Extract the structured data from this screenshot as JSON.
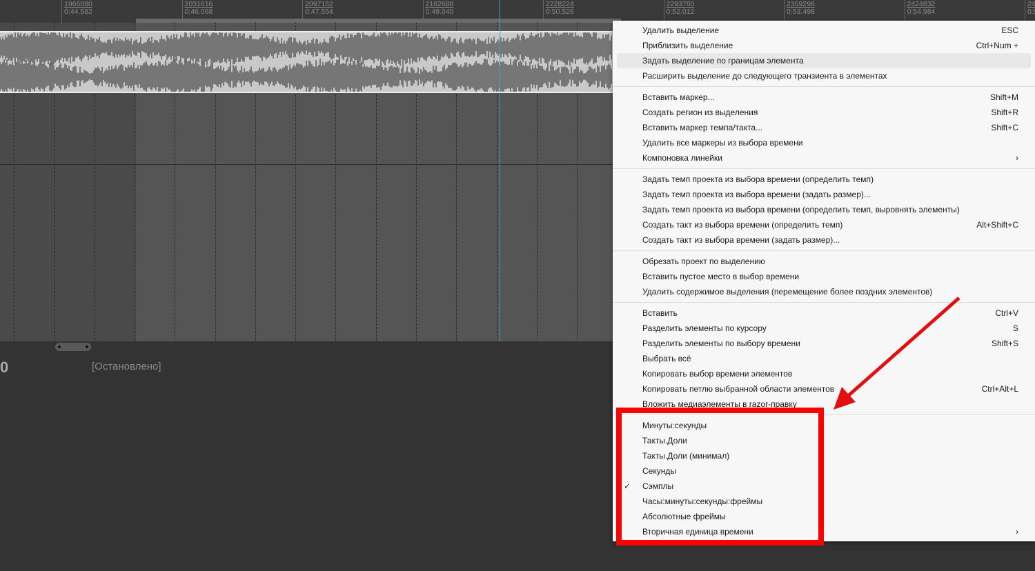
{
  "ruler": {
    "ticks": [
      {
        "samples": "1966080",
        "time": "0:44.582"
      },
      {
        "samples": "2031616",
        "time": "0:46.068"
      },
      {
        "samples": "2097152",
        "time": "0:47.554"
      },
      {
        "samples": "2162688",
        "time": "0:49.040"
      },
      {
        "samples": "2228224",
        "time": "0:50.526"
      },
      {
        "samples": "2293760",
        "time": "0:52.012"
      },
      {
        "samples": "2359296",
        "time": "0:53.498"
      },
      {
        "samples": "2424832",
        "time": "0:54.984"
      },
      {
        "samples": "24",
        "time": "0:5"
      }
    ]
  },
  "transport": {
    "timecode": "0",
    "status": "[Остановлено]"
  },
  "menu": {
    "groups": [
      [
        {
          "label": "Удалить выделение",
          "shortcut": "ESC"
        },
        {
          "label": "Приблизить выделение",
          "shortcut": "Ctrl+Num +"
        },
        {
          "label": "Задать выделение по границам элемента",
          "highlighted": true
        },
        {
          "label": "Расширить выделение до следующего транзиента в элементах"
        }
      ],
      [
        {
          "label": "Вставить маркер...",
          "shortcut": "Shift+M"
        },
        {
          "label": "Создать регион из выделения",
          "shortcut": "Shift+R"
        },
        {
          "label": "Вставить маркер темпа/такта...",
          "shortcut": "Shift+C"
        },
        {
          "label": "Удалить все маркеры из выбора времени"
        },
        {
          "label": "Компоновка линейки",
          "submenu": true
        }
      ],
      [
        {
          "label": "Задать темп проекта из выбора времени (определить темп)"
        },
        {
          "label": "Задать темп проекта из выбора времени (задать размер)..."
        },
        {
          "label": "Задать темп проекта из выбора времени (определить темп, выровнять элементы)"
        },
        {
          "label": "Создать такт из выбора времени (определить темп)",
          "shortcut": "Alt+Shift+C"
        },
        {
          "label": "Создать такт из выбора времени (задать размер)..."
        }
      ],
      [
        {
          "label": "Обрезать проект по выделению"
        },
        {
          "label": "Вставить пустое место в выбор времени"
        },
        {
          "label": "Удалить содержимое выделения (перемещение более поздних элементов)"
        }
      ],
      [
        {
          "label": "Вставить",
          "shortcut": "Ctrl+V"
        },
        {
          "label": "Разделить элементы по курсору",
          "shortcut": "S"
        },
        {
          "label": "Разделить элементы по выбору времени",
          "shortcut": "Shift+S"
        },
        {
          "label": "Выбрать всё"
        },
        {
          "label": "Копировать выбор времени элементов"
        },
        {
          "label": "Копировать петлю выбранной области элементов",
          "shortcut": "Ctrl+Alt+L"
        },
        {
          "label": "Вложить медиаэлементы в razor-правку"
        }
      ],
      [
        {
          "label": "Минуты:секунды"
        },
        {
          "label": "Такты.Доли"
        },
        {
          "label": "Такты.Доли (минимал)"
        },
        {
          "label": "Секунды"
        },
        {
          "label": "Сэмплы",
          "checked": true
        },
        {
          "label": "Часы:минуты:секунды:фреймы"
        },
        {
          "label": "Абсолютные фреймы"
        },
        {
          "label": "Вторичная единица времени",
          "submenu": true
        }
      ]
    ]
  },
  "colors": {
    "annotation": "#ff0000",
    "playhead": "#3aa4a8"
  }
}
